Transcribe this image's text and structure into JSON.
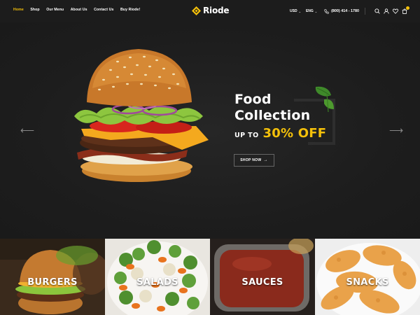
{
  "header": {
    "nav": [
      {
        "label": "Home",
        "active": true
      },
      {
        "label": "Shop",
        "active": false
      },
      {
        "label": "Our Menu",
        "active": false
      },
      {
        "label": "About Us",
        "active": false
      },
      {
        "label": "Contact Us",
        "active": false
      },
      {
        "label": "Buy Riode!",
        "active": false
      }
    ],
    "logo_text": "Riode",
    "currency": "USD",
    "language": "ENG",
    "phone": "(800) 414 - 1780",
    "icons": [
      "search-icon",
      "user-icon",
      "heart-icon",
      "cart-icon"
    ]
  },
  "hero": {
    "title_line1": "Food",
    "title_line2": "Collection",
    "upto": "UP TO",
    "discount": "30% OFF",
    "button_label": "SHOP NOW",
    "accent": "#f5c10a"
  },
  "categories": [
    {
      "label": "BURGERS"
    },
    {
      "label": "SALADS"
    },
    {
      "label": "SAUCES"
    },
    {
      "label": "SNACKS"
    }
  ]
}
